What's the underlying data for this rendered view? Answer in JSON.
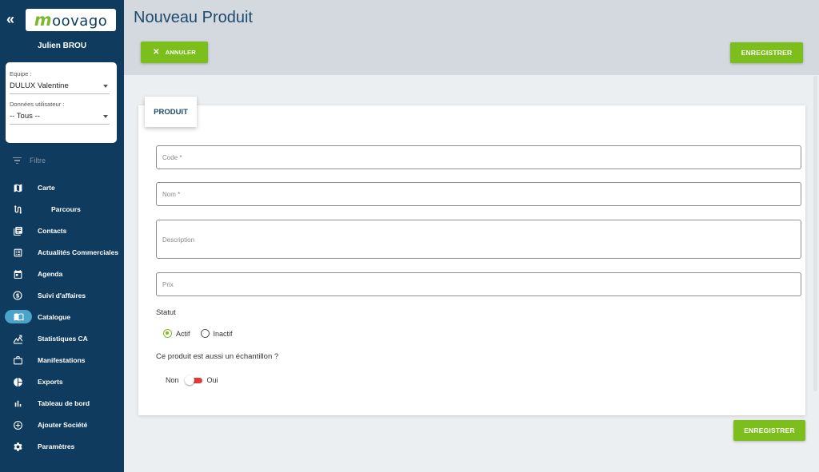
{
  "sidebar": {
    "logo": {
      "m": "m",
      "rest": "oovago"
    },
    "user_name": "Julien BROU",
    "equipe_label": "Equipe :",
    "equipe_value": "DULUX Valentine",
    "donnees_label": "Données utilisateur :",
    "donnees_value": "-- Tous --",
    "filter_label": "Filtre",
    "items": [
      {
        "label": "Carte",
        "icon": "map-icon"
      },
      {
        "label": "Parcours",
        "icon": "route-icon"
      },
      {
        "label": "Contacts",
        "icon": "contacts-icon"
      },
      {
        "label": "Actualités Commerciales",
        "icon": "news-icon"
      },
      {
        "label": "Agenda",
        "icon": "calendar-icon"
      },
      {
        "label": "Suivi d'affaires",
        "icon": "money-cycle-icon"
      },
      {
        "label": "Catalogue",
        "icon": "book-icon"
      },
      {
        "label": "Statistiques CA",
        "icon": "stats-icon"
      },
      {
        "label": "Manifestations",
        "icon": "briefcase-icon"
      },
      {
        "label": "Exports",
        "icon": "pie-icon"
      },
      {
        "label": "Tableau de bord",
        "icon": "bar-chart-icon"
      },
      {
        "label": "Ajouter Société",
        "icon": "add-circle-icon"
      },
      {
        "label": "Paramètres",
        "icon": "gear-icon"
      }
    ]
  },
  "header": {
    "title": "Nouveau Produit",
    "cancel_label": "ANNULER",
    "save_label": "ENREGISTRER"
  },
  "form": {
    "tab_label": "PRODUIT",
    "code_placeholder": "Code *",
    "nom_placeholder": "Nom *",
    "description_placeholder": "Description",
    "prix_placeholder": "Prix",
    "statut_label": "Statut",
    "actif_label": "Actif",
    "inactif_label": "Inactif",
    "sample_question": "Ce produit est aussi un échantillon ?",
    "non_label": "Non",
    "oui_label": "Oui",
    "save_label": "ENREGISTRER"
  },
  "colors": {
    "sidebar_bg": "#0f3b5e",
    "accent_green": "#7cbf1c",
    "active_nav": "#4aa3c8",
    "toggle_red": "#e53935"
  }
}
